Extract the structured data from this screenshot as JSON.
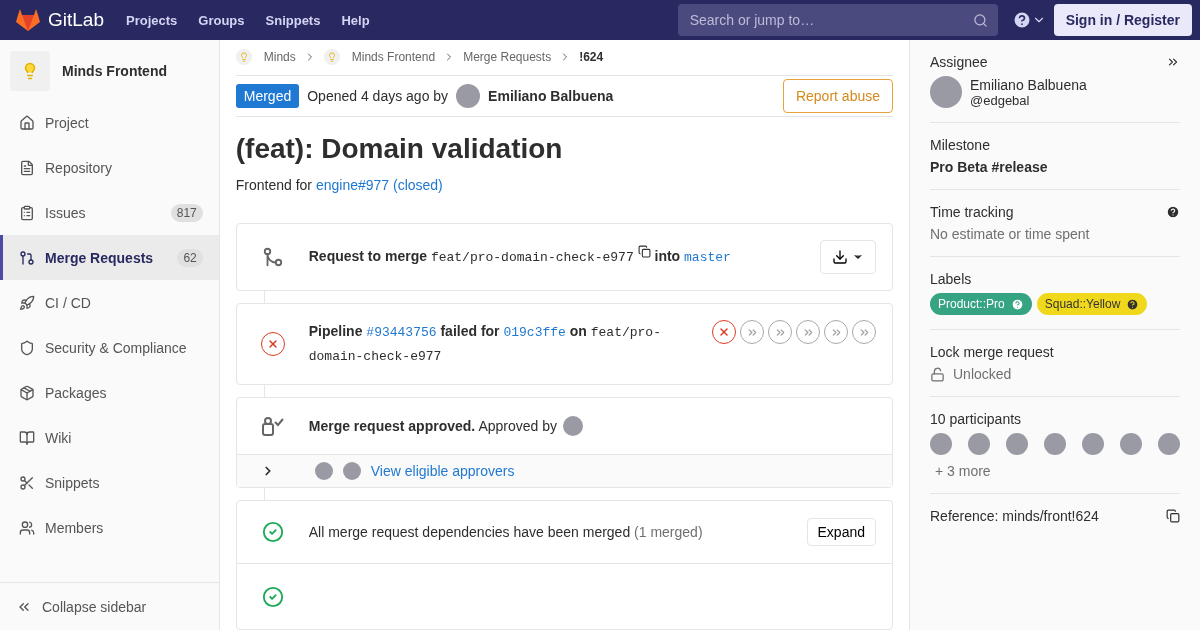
{
  "topbar": {
    "brand": "GitLab",
    "nav": [
      "Projects",
      "Groups",
      "Snippets",
      "Help"
    ],
    "search": {
      "placeholder": "Search or jump to…"
    },
    "signin": "Sign in / Register"
  },
  "sidebar": {
    "project": "Minds Frontend",
    "items": [
      {
        "label": "Project",
        "selected": false
      },
      {
        "label": "Repository",
        "selected": false
      },
      {
        "label": "Issues",
        "count": "817",
        "selected": false
      },
      {
        "label": "Merge Requests",
        "count": "62",
        "selected": true
      },
      {
        "label": "CI / CD",
        "selected": false
      },
      {
        "label": "Security & Compliance",
        "selected": false
      },
      {
        "label": "Packages",
        "selected": false
      },
      {
        "label": "Wiki",
        "selected": false
      },
      {
        "label": "Snippets",
        "selected": false
      },
      {
        "label": "Members",
        "selected": false
      }
    ],
    "collapse": "Collapse sidebar"
  },
  "breadcrumbs": [
    {
      "label": "Minds",
      "avatar": true
    },
    {
      "label": "Minds Frontend",
      "avatar": true
    },
    {
      "label": "Merge Requests",
      "avatar": false
    },
    {
      "label": "!624",
      "avatar": false
    }
  ],
  "header": {
    "status": "Merged",
    "opened": "Opened 4 days ago by",
    "author": "Emiliano Balbuena",
    "report": "Report abuse"
  },
  "title": "(feat): Domain validation",
  "description": {
    "text": "Frontend for",
    "link": "engine#977 (closed)"
  },
  "merge_request": {
    "prefix": "Request to merge",
    "source": "feat/pro-domain-check-e977",
    "into": "into",
    "target": "master"
  },
  "pipeline": {
    "label": "Pipeline",
    "id": "#93443756",
    "failed": "failed for",
    "commit": "019c3ffe",
    "on": "on",
    "branch": "feat/pro-domain-check-e977",
    "stages": [
      {
        "kind": "failed"
      },
      {
        "kind": "skipped"
      },
      {
        "kind": "skipped"
      },
      {
        "kind": "skipped"
      },
      {
        "kind": "skipped"
      },
      {
        "kind": "skipped"
      }
    ]
  },
  "approval": {
    "title": "Merge request approved.",
    "by": "Approved by",
    "approvers_link": "View eligible approvers",
    "expanded": false
  },
  "dependencies": {
    "text": "All merge request dependencies have been merged",
    "count": "(1 merged)",
    "button": "Expand"
  },
  "right_sidebar": {
    "assignee": {
      "heading": "Assignee",
      "name": "Emiliano Balbuena",
      "username": "@edgebal"
    },
    "milestone": {
      "heading": "Milestone",
      "value": "Pro Beta #release"
    },
    "time_tracking": {
      "heading": "Time tracking",
      "value": "No estimate or time spent"
    },
    "labels": {
      "heading": "Labels",
      "items": [
        {
          "label": "Product::Pro",
          "color": "#36a483"
        },
        {
          "label": "Squad::Yellow",
          "color": "#f0d91d"
        }
      ]
    },
    "lock": {
      "heading": "Lock merge request",
      "value": "Unlocked"
    },
    "participants": {
      "heading": "10 participants",
      "more": "+ 3 more"
    },
    "reference": "Reference: minds/front!624"
  }
}
